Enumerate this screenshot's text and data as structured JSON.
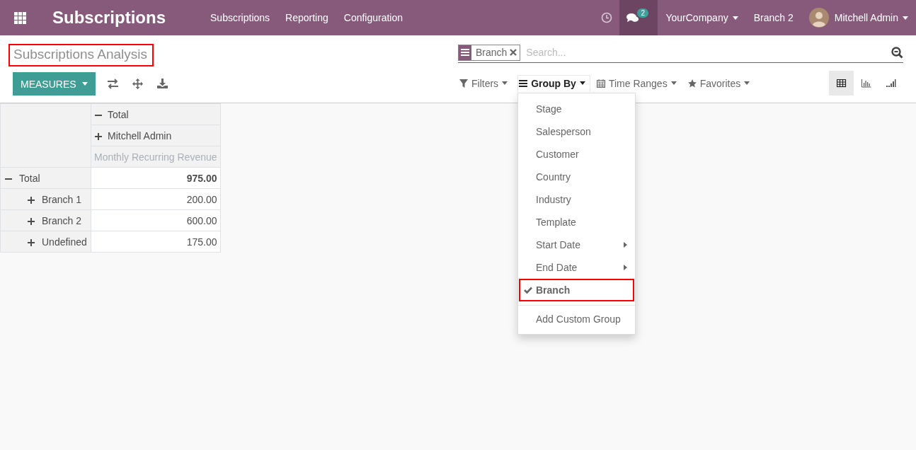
{
  "navbar": {
    "app_title": "Subscriptions",
    "menu": [
      "Subscriptions",
      "Reporting",
      "Configuration"
    ],
    "messages_count": "2",
    "company": "YourCompany",
    "branch": "Branch 2",
    "user": "Mitchell Admin"
  },
  "breadcrumb": {
    "title": "Subscriptions Analysis",
    "highlighted": true
  },
  "measures_button": "MEASURES",
  "search": {
    "facets": [
      {
        "label": "Branch"
      }
    ],
    "placeholder": "Search..."
  },
  "search_options": [
    {
      "kind": "filters",
      "label": "Filters",
      "open": false
    },
    {
      "kind": "groupby",
      "label": "Group By",
      "open": true
    },
    {
      "kind": "timeranges",
      "label": "Time Ranges",
      "open": false
    },
    {
      "kind": "favorites",
      "label": "Favorites",
      "open": false
    }
  ],
  "views": [
    {
      "kind": "pivot",
      "selected": true
    },
    {
      "kind": "graph",
      "selected": false
    },
    {
      "kind": "cohort",
      "selected": false
    }
  ],
  "group_by_menu": {
    "items": [
      {
        "label": "Stage",
        "checked": false,
        "submenu": false,
        "highlighted": false
      },
      {
        "label": "Salesperson",
        "checked": false,
        "submenu": false,
        "highlighted": false
      },
      {
        "label": "Customer",
        "checked": false,
        "submenu": false,
        "highlighted": false
      },
      {
        "label": "Country",
        "checked": false,
        "submenu": false,
        "highlighted": false
      },
      {
        "label": "Industry",
        "checked": false,
        "submenu": false,
        "highlighted": false
      },
      {
        "label": "Template",
        "checked": false,
        "submenu": false,
        "highlighted": false
      },
      {
        "label": "Start Date",
        "checked": false,
        "submenu": true,
        "highlighted": false
      },
      {
        "label": "End Date",
        "checked": false,
        "submenu": true,
        "highlighted": false
      },
      {
        "label": "Branch",
        "checked": true,
        "submenu": false,
        "highlighted": true
      }
    ],
    "custom_group": "Add Custom Group"
  },
  "pivot": {
    "col_headers": [
      {
        "label": "Total",
        "expanded": true
      },
      {
        "label": "Mitchell Admin",
        "expanded": false
      }
    ],
    "measure": "Monthly Recurring Revenue",
    "rows": [
      {
        "label": "Total",
        "expanded": true,
        "value": "975.00",
        "children": [
          {
            "label": "Branch 1",
            "expanded": false,
            "value": "200.00"
          },
          {
            "label": "Branch 2",
            "expanded": false,
            "value": "600.00"
          },
          {
            "label": "Undefined",
            "expanded": false,
            "value": "175.00"
          }
        ]
      }
    ]
  }
}
